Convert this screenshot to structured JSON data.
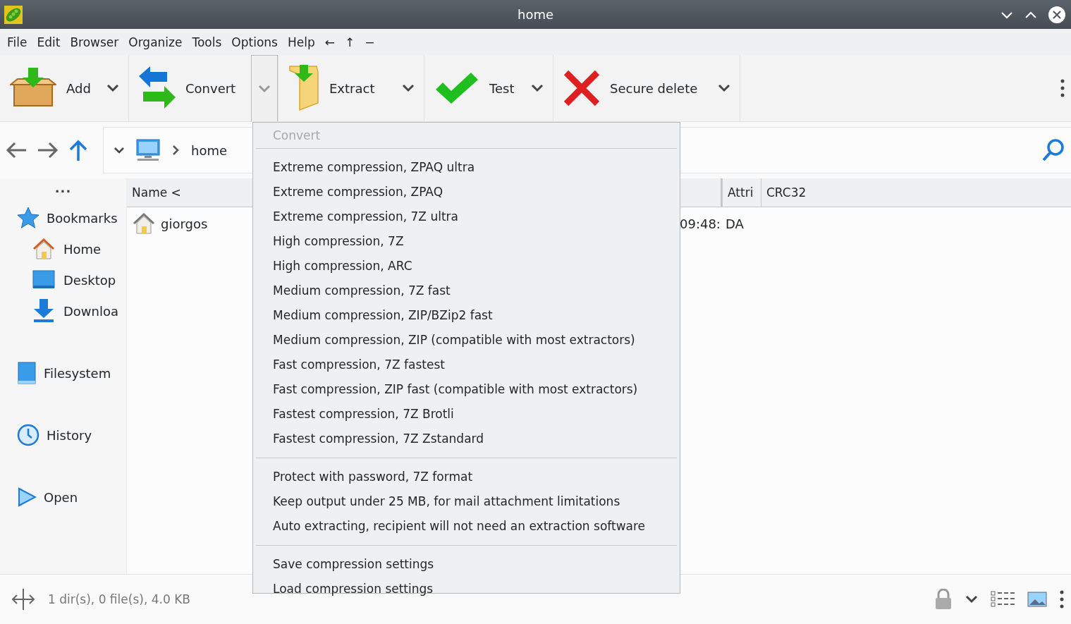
{
  "window": {
    "title": "home"
  },
  "menu_bar": [
    "File",
    "Edit",
    "Browser",
    "Organize",
    "Tools",
    "Options",
    "Help",
    "←",
    "↑",
    "−"
  ],
  "toolbar": [
    {
      "label": "Add",
      "open": false
    },
    {
      "label": "Convert",
      "open": true
    },
    {
      "label": "Extract",
      "open": false
    },
    {
      "label": "Test",
      "open": false
    },
    {
      "label": "Secure delete",
      "open": false
    }
  ],
  "address_bar": {
    "path": "home"
  },
  "sidebar": {
    "more": "...",
    "items": [
      {
        "label": "Bookmarks",
        "children": [
          {
            "label": "Home"
          },
          {
            "label": "Desktop"
          },
          {
            "label": "Downloa"
          }
        ]
      },
      {
        "label": "Filesystem"
      },
      {
        "label": "History"
      },
      {
        "label": "Open"
      }
    ]
  },
  "table": {
    "columns": [
      "Name <",
      "Attri",
      "CRC32"
    ],
    "rows": [
      {
        "name": "giorgos",
        "column_3": "09:48:",
        "attributes": "DA"
      }
    ]
  },
  "dropdown_menu": {
    "title": "Convert",
    "sections": [
      [
        "Extreme compression, ZPAQ ultra",
        "Extreme compression, ZPAQ",
        "Extreme compression, 7Z ultra",
        "High compression, 7Z",
        "High compression, ARC",
        "Medium compression, 7Z fast",
        "Medium compression, ZIP/BZip2 fast",
        "Medium compression, ZIP (compatible with most extractors)",
        "Fast compression, 7Z fastest",
        "Fast compression, ZIP fast (compatible with most extractors)",
        "Fastest compression, 7Z Brotli",
        "Fastest compression, 7Z Zstandard"
      ],
      [
        "Protect with password, 7Z format",
        "Keep output under 25 MB, for mail attachment limitations",
        "Auto extracting, recipient will not need an extraction software"
      ],
      [
        "Save compression settings",
        "Load compression settings"
      ]
    ]
  },
  "status_bar": {
    "text": "1 dir(s), 0 file(s), 4.0 KB"
  }
}
